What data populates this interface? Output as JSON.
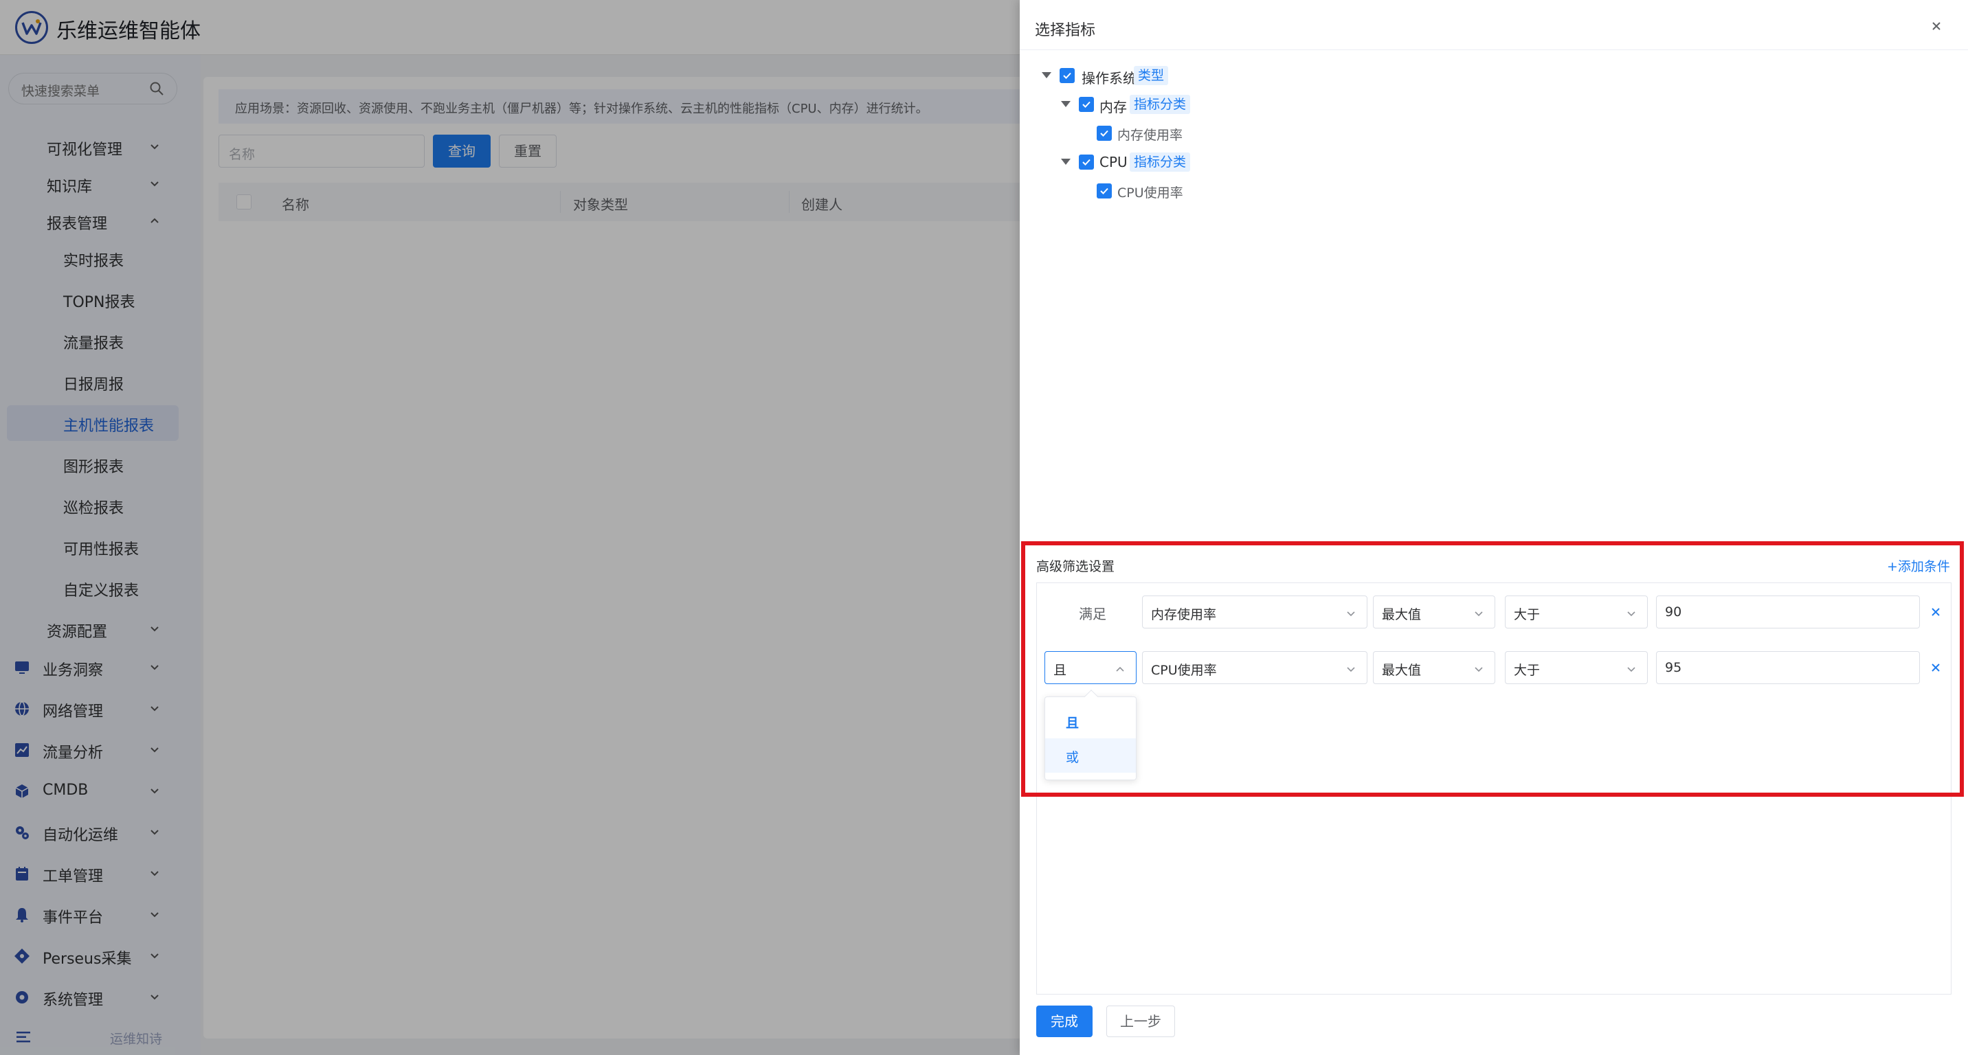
{
  "app": {
    "title": "乐维运维智能体"
  },
  "sidebar": {
    "search_placeholder": "快速搜索菜单",
    "items": [
      {
        "label": "可视化管理"
      },
      {
        "label": "知识库"
      },
      {
        "label": "报表管理"
      },
      {
        "label": "实时报表"
      },
      {
        "label": "TOPN报表"
      },
      {
        "label": "流量报表"
      },
      {
        "label": "日报周报"
      },
      {
        "label": "主机性能报表"
      },
      {
        "label": "图形报表"
      },
      {
        "label": "巡检报表"
      },
      {
        "label": "可用性报表"
      },
      {
        "label": "自定义报表"
      },
      {
        "label": "资源配置"
      },
      {
        "label": "业务洞察"
      },
      {
        "label": "网络管理"
      },
      {
        "label": "流量分析"
      },
      {
        "label": "CMDB"
      },
      {
        "label": "自动化运维"
      },
      {
        "label": "工单管理"
      },
      {
        "label": "事件平台"
      },
      {
        "label": "Perseus采集"
      },
      {
        "label": "系统管理"
      }
    ],
    "footer_label": "运维知诗"
  },
  "main": {
    "tip": "应用场景：资源回收、资源使用、不跑业务主机（僵尸机器）等；针对操作系统、云主机的性能指标（CPU、内存）进行统计。",
    "name_placeholder": "名称",
    "query_button": "查询",
    "reset_button": "重置",
    "columns": [
      "名称",
      "对象类型",
      "创建人"
    ]
  },
  "drawer": {
    "title": "选择指标",
    "tree": {
      "root": {
        "label": "操作系统",
        "tag": "类型"
      },
      "mem": {
        "label": "内存",
        "tag": "指标分类"
      },
      "mem_leaf": {
        "label": "内存使用率"
      },
      "cpu": {
        "label": "CPU",
        "tag": "指标分类"
      },
      "cpu_leaf": {
        "label": "CPU使用率"
      }
    },
    "advanced": {
      "title": "高级筛选设置",
      "add_condition": "+添加条件",
      "rows": [
        {
          "logic": "满足",
          "metric": "内存使用率",
          "agg": "最大值",
          "op": "大于",
          "value": "90"
        },
        {
          "logic": "且",
          "metric": "CPU使用率",
          "agg": "最大值",
          "op": "大于",
          "value": "95"
        }
      ],
      "logic_options": [
        {
          "label": "且",
          "selected": true
        },
        {
          "label": "或",
          "hovered": true
        }
      ]
    },
    "finish_button": "完成",
    "prev_button": "上一步"
  },
  "colors": {
    "primary": "#1e7cf0",
    "highlight_border": "#e0161e"
  }
}
